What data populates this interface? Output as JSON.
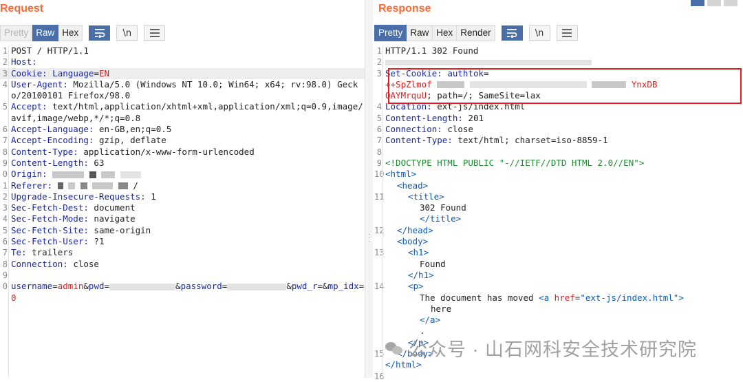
{
  "request": {
    "title": "Request",
    "tabs": [
      "Pretty",
      "Raw",
      "Hex"
    ],
    "icon_buttons": [
      "\\n"
    ],
    "lines": {
      "l1": {
        "n": "1",
        "text": "POST / HTTP/1.1"
      },
      "l2": {
        "n": "2",
        "key": "Host:"
      },
      "l3": {
        "n": "3",
        "key": "Cookie:",
        "pre": " ",
        "name": "Language",
        "eq": "=",
        "val": "EN"
      },
      "l4": {
        "n": "4",
        "key": "User-Agent:",
        "text": " Mozilla/5.0 (Windows NT 10.0; Win64; x64; rv:98.0) Gecko/20100101 Firefox/98.0"
      },
      "l5": {
        "n": "5",
        "key": "Accept:",
        "text": " text/html,application/xhtml+xml,application/xml;q=0.9,image/avif,image/webp,*/*;q=0.8"
      },
      "l6": {
        "n": "6",
        "key": "Accept-Language:",
        "text": " en-GB,en;q=0.5"
      },
      "l7": {
        "n": "7",
        "key": "Accept-Encoding:",
        "text": " gzip, deflate"
      },
      "l8": {
        "n": "8",
        "key": "Content-Type:",
        "text": " application/x-www-form-urlencoded"
      },
      "l9": {
        "n": "9",
        "key": "Content-Length:",
        "text": " 63"
      },
      "l10": {
        "n": "0",
        "key": "Origin:"
      },
      "l11": {
        "n": "1",
        "key": "Referer:",
        "text": "/"
      },
      "l12": {
        "n": "2",
        "key": "Upgrade-Insecure-Requests:",
        "text": " 1"
      },
      "l13": {
        "n": "3",
        "key": "Sec-Fetch-Dest:",
        "text": " document"
      },
      "l14": {
        "n": "4",
        "key": "Sec-Fetch-Mode:",
        "text": " navigate"
      },
      "l15": {
        "n": "5",
        "key": "Sec-Fetch-Site:",
        "text": " same-origin"
      },
      "l16": {
        "n": "6",
        "key": "Sec-Fetch-User:",
        "text": " ?1"
      },
      "l17": {
        "n": "7",
        "key": "Te:",
        "text": " trailers"
      },
      "l18": {
        "n": "8",
        "key": "Connection:",
        "text": " close"
      },
      "l19": {
        "n": "9"
      },
      "l20": {
        "n": "0",
        "p1": "username",
        "e1": "=",
        "v1": "admin",
        "a1": "&",
        "p2": "pwd",
        "e2": "=",
        "a2": "&",
        "p3": "password",
        "e3": "=",
        "a3": "&",
        "p4": "pwd_r",
        "e4": "=",
        "a4": "&",
        "p5": "mp_idx",
        "e5": "=",
        "v5": "0"
      }
    }
  },
  "response": {
    "title": "Response",
    "tabs": [
      "Pretty",
      "Raw",
      "Hex",
      "Render"
    ],
    "icon_buttons": [
      "\\n"
    ],
    "lines": {
      "l1": {
        "n": "1",
        "text": "HTTP/1.1 302 Found"
      },
      "l2": {
        "n": "2"
      },
      "l3": {
        "n": "3",
        "key": "Set-Cookie:",
        "pre": " ",
        "name": "authtok",
        "eq": "=",
        "v1": "++SpZlmof",
        "v2": "YnxDB",
        "v3": "OAYMrquU",
        "rest": "; path=/; SameSite=lax"
      },
      "l4": {
        "n": "4",
        "key": "Location:",
        "text": " ext-js/index.html"
      },
      "l5": {
        "n": "5",
        "key": "Content-Length:",
        "text": " 201"
      },
      "l6": {
        "n": "6",
        "key": "Connection:",
        "text": " close"
      },
      "l7": {
        "n": "7",
        "key": "Content-Type:",
        "text": " text/html; charset=iso-8859-1"
      },
      "l8": {
        "n": "8"
      },
      "l9": {
        "n": "9",
        "text": "<!DOCTYPE HTML PUBLIC \"-//IETF//DTD HTML 2.0//EN\">"
      },
      "l10": {
        "n": "10",
        "text": "<html>"
      },
      "l10b": {
        "text": "<head>"
      },
      "l11": {
        "n": "11",
        "text": "<title>"
      },
      "l11b": {
        "text": "302 Found"
      },
      "l11c": {
        "text": "</title>"
      },
      "l12": {
        "n": "12",
        "text": "</head>"
      },
      "l12b": {
        "text": "<body>"
      },
      "l13": {
        "n": "13",
        "text": "<h1>"
      },
      "l13b": {
        "text": "Found"
      },
      "l13c": {
        "text": "</h1>"
      },
      "l14": {
        "n": "14",
        "text": "<p>"
      },
      "l14b": {
        "pre": "The document has moved ",
        "tag_open": "<a ",
        "attr": "href",
        "eq": "=",
        "val": "\"ext-js/index.html\"",
        "close": ">"
      },
      "l14c": {
        "text": "here"
      },
      "l14d": {
        "text": "</a>"
      },
      "l14e": {
        "text": "."
      },
      "l14f": {
        "text": "</p>"
      },
      "l15": {
        "n": "15",
        "text": "</body>"
      },
      "l15b": {
        "text": "</html>"
      },
      "l16": {
        "n": "16"
      }
    }
  },
  "watermark": "公众号 · 山石网科安全技术研究院",
  "colors": {
    "accent": "#ff6633",
    "active_tab": "#4a6fa8",
    "highlight_box": "#e41d1d",
    "header_key": "#1a28a0",
    "param_value": "#d62220",
    "html_tag": "#0e58b4",
    "doctype": "#1d8a2e"
  }
}
